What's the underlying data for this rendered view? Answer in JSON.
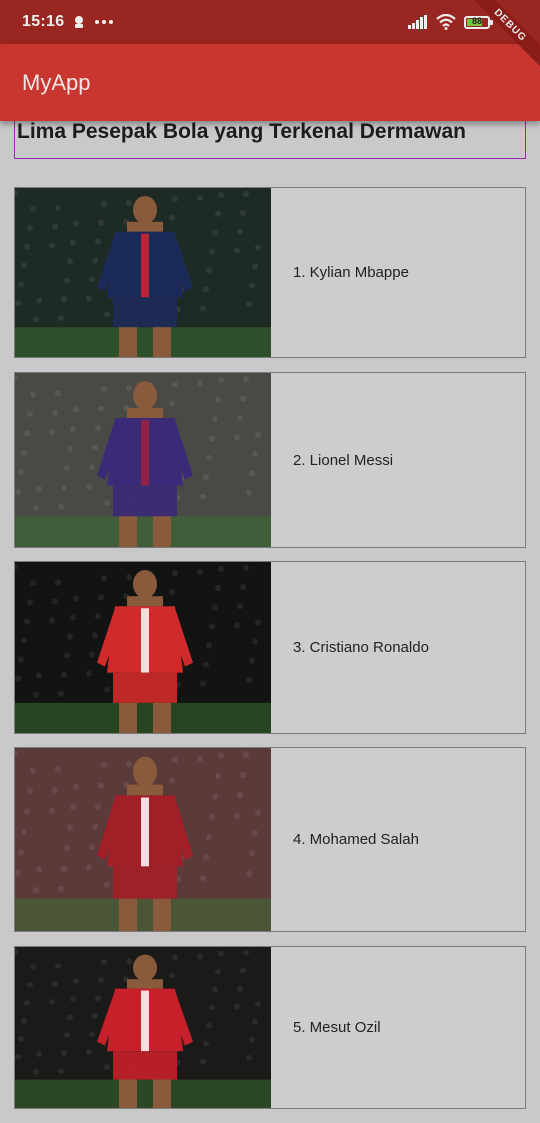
{
  "status_bar": {
    "time": "15:16",
    "battery_level": "88",
    "debug_label": "DEBUG"
  },
  "app_bar": {
    "title": "MyApp"
  },
  "header": {
    "title": "Lima Pesepak Bola yang Terkenal Dermawan"
  },
  "players": [
    {
      "label": "1. Kylian Mbappe",
      "kit": "#1c2a5a",
      "accent": "#d22630",
      "background": "#1e2b24"
    },
    {
      "label": "2. Lionel Messi",
      "kit": "#3b2a78",
      "accent": "#a0203a",
      "background": "#4a4a44"
    },
    {
      "label": "3. Cristiano Ronaldo",
      "kit": "#d12a2a",
      "accent": "#ffffff",
      "background": "#111412"
    },
    {
      "label": "4. Mohamed Salah",
      "kit": "#a31f28",
      "accent": "#ffffff",
      "background": "#5b3a3a"
    },
    {
      "label": "5. Mesut Ozil",
      "kit": "#c8202a",
      "accent": "#ffffff",
      "background": "#1a1a18"
    }
  ],
  "icons": {
    "notification": "person-icon",
    "more": "more-dots-icon",
    "signal": "signal-icon",
    "wifi": "wifi-icon",
    "battery": "battery-icon"
  }
}
